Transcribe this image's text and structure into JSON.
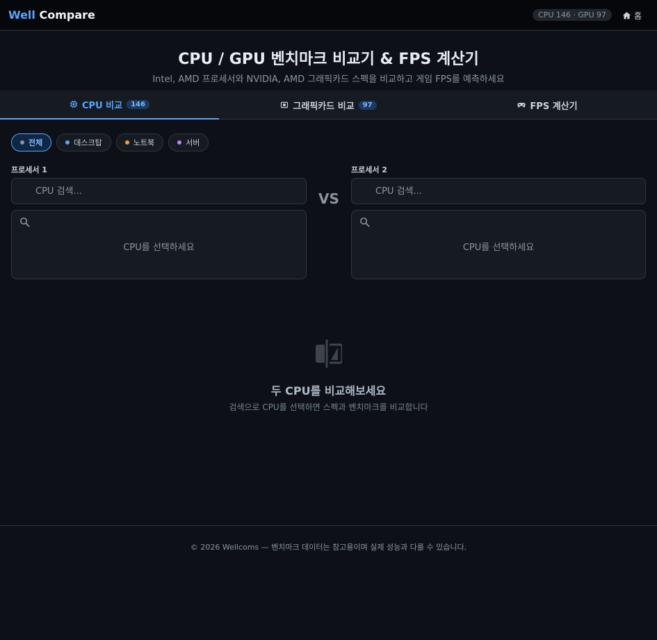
{
  "brand": {
    "part1": "Well",
    "part2": "Compare"
  },
  "header": {
    "stats": "CPU 146 · GPU 97",
    "home_label": "홈"
  },
  "hero": {
    "title": "CPU / GPU 벤치마크 비교기 & FPS 계산기",
    "subtitle": "Intel, AMD 프로세서와 NVIDIA, AMD 그래픽카드 스펙을 비교하고 게임 FPS를 예측하세요"
  },
  "tabs": [
    {
      "label": "CPU 비교",
      "count": "146",
      "icon": "cpu-icon",
      "active": true
    },
    {
      "label": "그래픽카드 비교",
      "count": "97",
      "icon": "gpu-icon",
      "active": false
    },
    {
      "label": "FPS 계산기",
      "count": "",
      "icon": "gamepad-icon",
      "active": false
    }
  ],
  "filters": [
    {
      "label": "전체",
      "color": "#8b949e",
      "active": true
    },
    {
      "label": "데스크탑",
      "color": "#58a6ff",
      "active": false
    },
    {
      "label": "노트북",
      "color": "#f0a030",
      "active": false
    },
    {
      "label": "서버",
      "color": "#c080ff",
      "active": false
    }
  ],
  "compare": {
    "slot1": {
      "label": "프로세서 1",
      "placeholder": "CPU 검색...",
      "empty": "CPU를 선택하세요"
    },
    "slot2": {
      "label": "프로세서 2",
      "placeholder": "CPU 검색...",
      "empty": "CPU를 선택하세요"
    },
    "vs": "VS"
  },
  "empty_state": {
    "title": "두 CPU를 비교해보세요",
    "subtitle": "검색으로 CPU를 선택하면 스펙과 벤치마크를 비교합니다"
  },
  "footer": {
    "text": "© 2026 Wellcoms — 벤치마크 데이터는 참고용이며 실제 성능과 다를 수 있습니다."
  },
  "colors": {
    "accent": "#58a6ff",
    "background": "#0d1117",
    "surface": "#161b22"
  }
}
